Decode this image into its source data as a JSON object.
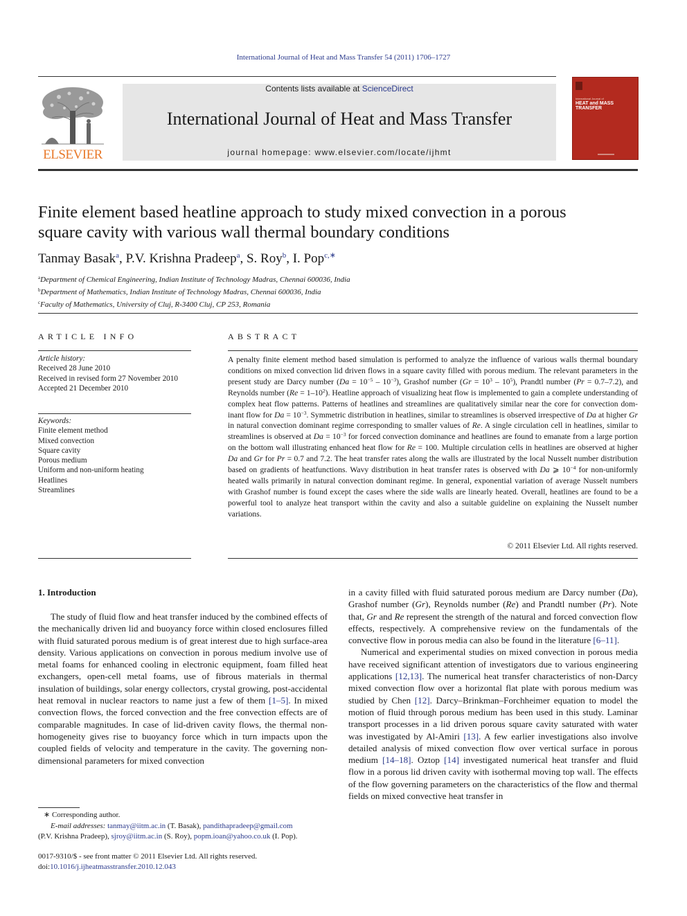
{
  "running_head": "International Journal of Heat and Mass Transfer 54 (2011) 1706–1727",
  "masthead": {
    "publisher_logo_text": "ELSEVIER",
    "contents_prefix": "Contents lists available at ",
    "contents_link": "ScienceDirect",
    "journal_name": "International Journal of Heat and Mass Transfer",
    "homepage_label": "journal homepage: ",
    "homepage_url": "www.elsevier.com/locate/ijhmt",
    "cover": {
      "subtitle": "International Journal of",
      "title_line1": "HEAT and MASS",
      "title_line2": "TRANSFER",
      "color": "#b32a1f"
    }
  },
  "article": {
    "title_line1": "Finite element based heatline approach to study mixed convection in a porous",
    "title_line2": "square cavity with various wall thermal boundary conditions",
    "authors": [
      {
        "name": "Tanmay Basak",
        "sup": "a",
        "sep": ", "
      },
      {
        "name": "P.V. Krishna Pradeep",
        "sup": "a",
        "sep": ", "
      },
      {
        "name": "S. Roy",
        "sup": "b",
        "sep": ", "
      },
      {
        "name": "I. Pop",
        "sup": "c,∗",
        "sep": ""
      }
    ],
    "affiliations": [
      {
        "label": "a",
        "text": "Department of Chemical Engineering, Indian Institute of Technology Madras, Chennai 600036, India"
      },
      {
        "label": "b",
        "text": "Department of Mathematics, Indian Institute of Technology Madras, Chennai 600036, India"
      },
      {
        "label": "c",
        "text": "Faculty of Mathematics, University of Cluj, R-3400 Cluj, CP 253, Romania"
      }
    ]
  },
  "article_info": {
    "heading": "ARTICLE INFO",
    "history_label": "Article history:",
    "history": [
      "Received 28 June 2010",
      "Received in revised form 27 November 2010",
      "Accepted 21 December 2010"
    ],
    "keywords_label": "Keywords:",
    "keywords": [
      "Finite element method",
      "Mixed convection",
      "Square cavity",
      "Porous medium",
      "Uniform and non-uniform heating",
      "Heatlines",
      "Streamlines"
    ]
  },
  "abstract": {
    "heading": "ABSTRACT",
    "s1": "A penalty finite element method based simulation is performed to analyze the influence of various walls thermal boundary conditions on mixed convection lid driven flows in a square cavity filled with porous medium. The relevant parameters in the present study are Darcy number (",
    "da": "Da",
    "eq1": " = 10",
    "exp_m5": "−5",
    "dash1": " – 10",
    "exp_m3": "−3",
    "s2": "), Grashof number (",
    "gr": "Gr",
    "eq2": " = 10",
    "exp_3": "3",
    "dash2": " – 10",
    "exp_5": "5",
    "s3": "), Prandtl number (",
    "pr": "Pr",
    "s4": " = 0.7–7.2), and Reynolds number (",
    "re": "Re",
    "s5": " = 1–10",
    "exp_2": "2",
    "s6": "). Heatline approach of visualizing heat flow is implemented to gain a complete understanding of complex heat flow patterns. Patterns of heatlines and streamlines are qualitatively similar near the core for convection dom­inant flow for ",
    "s7": " = 10",
    "s8": ". Symmetric distribution in heatlines, similar to streamlines is observed irrespec­tive of ",
    "s9": " at higher ",
    "s10": " in natural convection dominant regime corresponding to smaller values of ",
    "s11": ". A single circulation cell in heatlines, similar to streamlines is observed at ",
    "s12": " = 10",
    "s13": " for forced convection dominance and heatlines are found to emanate from a large portion on the bottom wall illustrating enhanced heat flow for ",
    "s14": " = 100. Multiple circulation cells in heatlines are observed at higher ",
    "s15": " and ",
    "s16": " for ",
    "s17": " = 0.7 and 7.2. The heat transfer rates along the walls are illustrated by the local Nusselt number distribution based on gradients of heatfunctions. Wavy distribution in heat transfer rates is observed with ",
    "s18": " ⩾ 10",
    "exp_m4": "−4",
    "s19": " for non-uniformly heated walls primarily in natural convection dominant regime. In gen­eral, exponential variation of average Nusselt numbers with Grashof number is found except the cases where the side walls are linearly heated. Overall, heatlines are found to be a powerful tool to analyze heat transport within the cavity and also a suitable guideline on explaining the Nusselt number variations.",
    "copyright": "© 2011 Elsevier Ltd. All rights reserved."
  },
  "introduction": {
    "heading": "1. Introduction",
    "col1_a": "The study of fluid flow and heat transfer induced by the com­bined effects of the mechanically driven lid and buoyancy force within closed enclosures filled with fluid saturated porous medium is of great interest due to high surface-area density. Various appli­cations on convection in porous medium involve use of metal foams for enhanced cooling in electronic equipment, foam filled heat exchangers, open-cell metal foams, use of fibrous materials in thermal insulation of buildings, solar energy collectors, crystal growing, post-accidental heat removal in nuclear reactors to name just a few of them ",
    "ref_1_5": "[1–5]",
    "col1_b": ". In mixed convection flows, the forced convection and the free convection effects are of comparable magnitudes. In case of lid-driven cavity flows, the thermal non­homogeneity gives rise to buoyancy force which in turn impacts upon the coupled fields of velocity and temperature in the cavity. The governing non-dimensional parameters for mixed convection",
    "col2_p1_a": "in a cavity filled with fluid saturated porous medium are Darcy number (",
    "col2_p1_b": "), Grashof number (",
    "col2_p1_c": "), Reynolds number (",
    "col2_p1_d": ") and Pra­ndtl number (",
    "col2_p1_e": "). Note that, ",
    "col2_p1_f": " and ",
    "col2_p1_g": " represent the strength of the natural and forced convection flow effects, respectively. A compre­hensive review on the fundamentals of the convective flow in por­ous media can also be found in the literature ",
    "ref_6_11": "[6–11]",
    "col2_p1_h": ".",
    "col2_p2_a": "Numerical and experimental studies on mixed convection in porous media have received significant attention of investigators due to various engineering applications ",
    "ref_12_13": "[12,13]",
    "col2_p2_b": ". The numerical heat transfer characteristics of non-Darcy mixed convection flow over a horizontal flat plate with porous medium was studied by Chen ",
    "ref_12": "[12]",
    "col2_p2_c": ". Darcy–Brinkman–Forchheimer equation to model the motion of fluid through porous medium has been used in this study. Laminar transport processes in a lid driven porous square cavity saturated with water was investigated by Al-Amiri ",
    "ref_13": "[13]",
    "col2_p2_d": ". A few earlier investigations also involve detailed analysis of mixed convection flow over vertical surface in porous medium ",
    "ref_14_18": "[14–18]",
    "col2_p2_e": ". Oztop ",
    "ref_14": "[14]",
    "col2_p2_f": " investigated numerical heat transfer and fluid flow in a porous lid driven cavity with isothermal moving top wall. The effects of the flow governing parameters on the characteristics of the flow and thermal fields on mixed convective heat transfer in"
  },
  "footnotes": {
    "star": "∗",
    "corresponding": " Corresponding author.",
    "email_label": "E-mail addresses: ",
    "emails": [
      {
        "address": "tanmay@iitm.ac.in",
        "owner": " (T. Basak), "
      },
      {
        "address": "pandithapradeep@gmail.com",
        "owner": " (P.V. Krishna Pradeep), "
      },
      {
        "address": "sjroy@iitm.ac.in",
        "owner": " (S. Roy), "
      },
      {
        "address": "popm.ioan@yahoo.co.uk",
        "owner": " (I. Pop)."
      }
    ],
    "issn_line": "0017-9310/$ - see front matter © 2011 Elsevier Ltd. All rights reserved.",
    "doi_label": "doi:",
    "doi": "10.1016/j.ijheatmasstransfer.2010.12.043"
  },
  "colors": {
    "link": "#2b3a8c",
    "elsevier_orange": "#e8792a",
    "banner_gray": "#e6e6e6"
  }
}
